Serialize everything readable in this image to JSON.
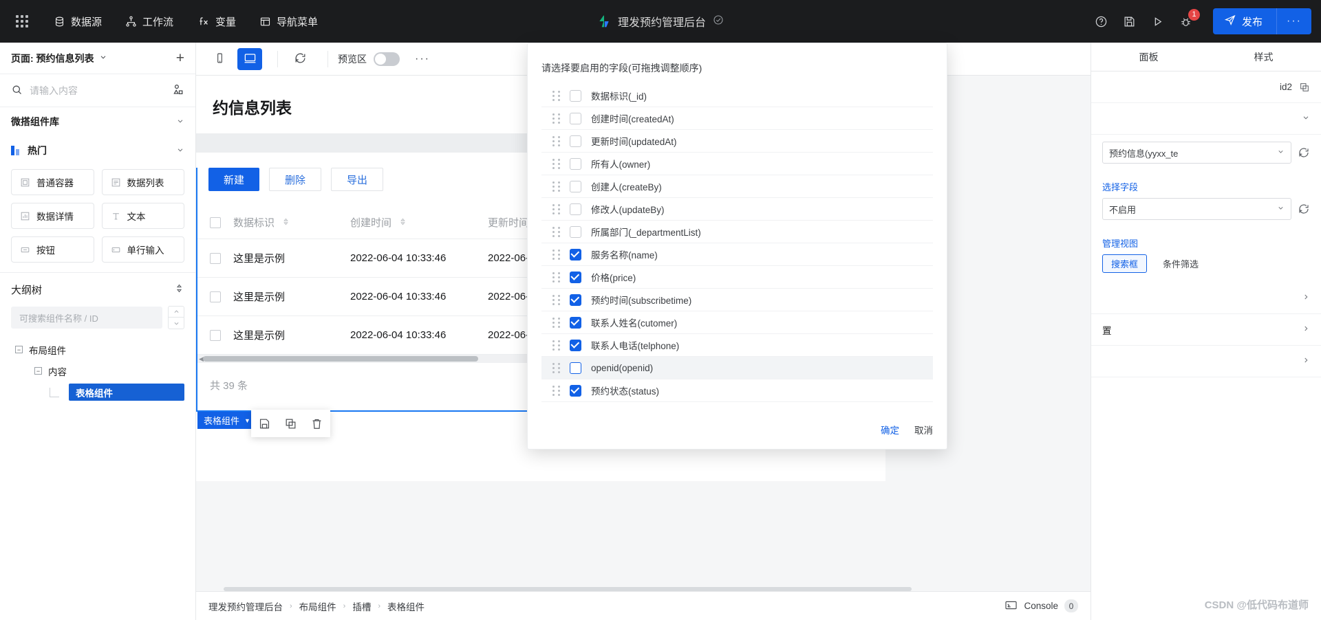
{
  "topbar": {
    "menu_icon": "grid-apps-icon",
    "nav": [
      {
        "label": "数据源",
        "icon": "database-icon"
      },
      {
        "label": "工作流",
        "icon": "workflow-icon"
      },
      {
        "label": "变量",
        "icon": "fx-icon"
      },
      {
        "label": "导航菜单",
        "icon": "nav-menu-icon"
      }
    ],
    "app_title": "理发预约管理后台",
    "app_status_icon": "check-circle-icon",
    "actions": [
      {
        "icon": "help-circle-icon"
      },
      {
        "icon": "save-disk-icon"
      },
      {
        "icon": "play-icon"
      },
      {
        "icon": "bug-icon",
        "badge": "1"
      }
    ],
    "publish_label": "发布",
    "publish_icon": "send-icon",
    "publish_more": "···",
    "accent": "#1261e6",
    "badge_color": "#e54545"
  },
  "sidebar": {
    "page_label": "页面: 预约信息列表",
    "add_page_label": "+",
    "search_placeholder": "请输入内容",
    "search_icon": "search-icon",
    "custom_comp_icon": "custom-component-icon",
    "library_title": "微搭组件库",
    "hot_title": "热门",
    "components": [
      {
        "label": "普通容器",
        "icon": "container-icon"
      },
      {
        "label": "数据列表",
        "icon": "list-icon"
      },
      {
        "label": "数据详情",
        "icon": "detail-chart-icon"
      },
      {
        "label": "文本",
        "icon": "text-icon"
      },
      {
        "label": "按钮",
        "icon": "button-icon"
      },
      {
        "label": "单行输入",
        "icon": "input-icon"
      }
    ],
    "outline_title": "大纲树",
    "outline_placeholder": "可搜索组件名称 / ID",
    "tree": [
      {
        "label": "布局组件",
        "level": 1,
        "expanded": true,
        "selected": false
      },
      {
        "label": "内容",
        "level": 2,
        "expanded": true,
        "selected": false
      },
      {
        "label": "表格组件",
        "level": 3,
        "expanded": false,
        "selected": true
      }
    ]
  },
  "canvas_toolbar": {
    "mobile_icon": "mobile-device-icon",
    "desktop_icon": "desktop-device-icon",
    "refresh_icon": "refresh-icon",
    "preview_label": "预览区",
    "preview_enabled": false,
    "more_label": "···"
  },
  "canvas": {
    "page_heading": "约信息列表",
    "buttons": {
      "create": "新建",
      "delete": "删除",
      "export": "导出"
    },
    "table": {
      "columns": [
        "数据标识",
        "创建时间",
        "更新时间"
      ],
      "rows": [
        {
          "id": "这里是示例",
          "created": "2022-06-04 10:33:46",
          "updated": "2022-06-0"
        },
        {
          "id": "这里是示例",
          "created": "2022-06-04 10:33:46",
          "updated": "2022-06-0"
        },
        {
          "id": "这里是示例",
          "created": "2022-06-04 10:33:46",
          "updated": "2022-06-0"
        }
      ],
      "pager_text": "共 39 条"
    },
    "selection_tag": "表格组件",
    "selection_caret": "▼",
    "float_tools": [
      {
        "icon": "save-disk-icon"
      },
      {
        "icon": "copy-icon"
      },
      {
        "icon": "trash-icon"
      }
    ]
  },
  "modal": {
    "title": "请选择要启用的字段(可拖拽调整顺序)",
    "fields": [
      {
        "label": "数据标识(_id)",
        "checked": false,
        "hover": false
      },
      {
        "label": "创建时间(createdAt)",
        "checked": false,
        "hover": false
      },
      {
        "label": "更新时间(updatedAt)",
        "checked": false,
        "hover": false
      },
      {
        "label": "所有人(owner)",
        "checked": false,
        "hover": false
      },
      {
        "label": "创建人(createBy)",
        "checked": false,
        "hover": false
      },
      {
        "label": "修改人(updateBy)",
        "checked": false,
        "hover": false
      },
      {
        "label": "所属部门(_departmentList)",
        "checked": false,
        "hover": false
      },
      {
        "label": "服务名称(name)",
        "checked": true,
        "hover": false
      },
      {
        "label": "价格(price)",
        "checked": true,
        "hover": false
      },
      {
        "label": "预约时间(subscribetime)",
        "checked": true,
        "hover": false
      },
      {
        "label": "联系人姓名(cutomer)",
        "checked": true,
        "hover": false
      },
      {
        "label": "联系人电话(telphone)",
        "checked": true,
        "hover": false
      },
      {
        "label": "openid(openid)",
        "checked": false,
        "hover": true
      },
      {
        "label": "预约状态(status)",
        "checked": true,
        "hover": false
      }
    ],
    "confirm": "确定",
    "cancel": "取消"
  },
  "right_panel": {
    "tabs": [
      {
        "label": "面板",
        "active": false
      },
      {
        "label": "样式",
        "active": false
      }
    ],
    "id_value": "id2",
    "copy_icon": "copy-icon",
    "rows": [
      {
        "label": "",
        "value": ""
      }
    ],
    "data_source": {
      "value": "预约信息(yyxx_te",
      "refresh_icon": "refresh-icon"
    },
    "field_select": {
      "label": "选择字段",
      "value": "不启用",
      "refresh_icon": "refresh-icon"
    },
    "manage_view_label": "管理视图",
    "view_tabs": [
      {
        "label": "搜索框",
        "active": true
      },
      {
        "label": "条件筛选",
        "active": false
      }
    ],
    "sections": [
      "",
      "置",
      ""
    ]
  },
  "bottom": {
    "breadcrumb": [
      "理发预约管理后台",
      "布局组件",
      "插槽",
      "表格组件"
    ],
    "console_label": "Console",
    "console_count": "0",
    "console_icon": "console-icon"
  },
  "watermark": "CSDN @低代码布道师"
}
